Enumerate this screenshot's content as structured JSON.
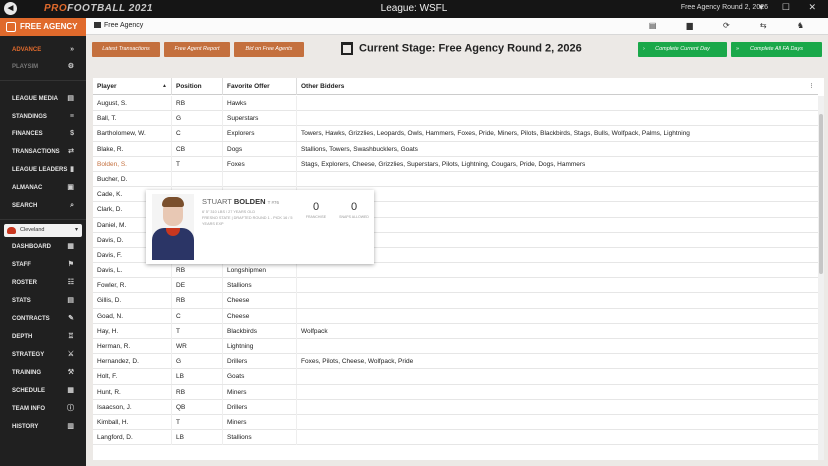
{
  "titlebar": {
    "logo_prefix": "PRO",
    "logo_suffix": "FOOTBALL 2021",
    "league": "League: WSFL",
    "stage": "Free Agency Round 2, 2026",
    "window_controls": "▾ ☐ ✕"
  },
  "sidebar": {
    "header": "FREE AGENCY",
    "advance": "ADVANCE",
    "advance_icon": "»",
    "playsim": "PLAYSIM",
    "playsim_icon": "⚙",
    "items": [
      {
        "label": "LEAGUE MEDIA",
        "icon": "▤"
      },
      {
        "label": "STANDINGS",
        "icon": "≡"
      },
      {
        "label": "FINANCES",
        "icon": "$"
      },
      {
        "label": "TRANSACTIONS",
        "icon": "⇄"
      },
      {
        "label": "LEAGUE LEADERS",
        "icon": "▮"
      },
      {
        "label": "ALMANAC",
        "icon": "▣"
      },
      {
        "label": "SEARCH",
        "icon": "⌕"
      }
    ],
    "team_select": "Cleveland",
    "team_items": [
      {
        "label": "DASHBOARD",
        "icon": "▦"
      },
      {
        "label": "STAFF",
        "icon": "⚑"
      },
      {
        "label": "ROSTER",
        "icon": "☷"
      },
      {
        "label": "STATS",
        "icon": "▤"
      },
      {
        "label": "CONTRACTS",
        "icon": "✎"
      },
      {
        "label": "DEPTH",
        "icon": "♖"
      },
      {
        "label": "STRATEGY",
        "icon": "⚔"
      },
      {
        "label": "TRAINING",
        "icon": "⚒"
      },
      {
        "label": "SCHEDULE",
        "icon": "▦"
      },
      {
        "label": "TEAM INFO",
        "icon": "ⓘ"
      },
      {
        "label": "HISTORY",
        "icon": "▥"
      }
    ]
  },
  "topbar": {
    "breadcrumb": "Free Agency",
    "icons": "▤ ▆ ⟳ ⇆ ♞"
  },
  "actions": {
    "latest_transactions": "Latest Transactions",
    "free_agent_report": "Free Agent Report",
    "bid_on_free_agents": "Bid on Free Agents",
    "stage_title": "Current Stage: Free Agency Round 2, 2026",
    "complete_day": "Complete Current Day",
    "complete_all": "Complete All FA Days",
    "complete_day_icon": "›",
    "complete_all_icon": "»"
  },
  "table": {
    "headers": [
      "Player",
      "Position",
      "Favorite Offer",
      "Other Bidders"
    ],
    "sort_indicator": "▲",
    "menu_indicator": "⋮",
    "rows": [
      {
        "player": "August, S.",
        "pos": "RB",
        "offer": "Hawks",
        "bidders": ""
      },
      {
        "player": "Ball, T.",
        "pos": "G",
        "offer": "Superstars",
        "bidders": ""
      },
      {
        "player": "Bartholomew, W.",
        "pos": "C",
        "offer": "Explorers",
        "bidders": "Towers, Hawks, Grizzlies, Leopards, Owls, Hammers, Foxes, Pride, Miners, Pilots, Blackbirds, Stags, Bulls, Wolfpack, Palms, Lightning"
      },
      {
        "player": "Blake, R.",
        "pos": "CB",
        "offer": "Dogs",
        "bidders": "Stallions, Towers, Swashbucklers, Goats"
      },
      {
        "player": "Bolden, S.",
        "pos": "T",
        "offer": "Foxes",
        "bidders": "Stags, Explorers, Cheese, Grizzlies, Superstars, Pilots, Lightning, Cougars, Pride, Dogs, Hammers"
      },
      {
        "player": "Bucher, D.",
        "pos": "",
        "offer": "",
        "bidders": ""
      },
      {
        "player": "Cade, K.",
        "pos": "",
        "offer": "",
        "bidders": ""
      },
      {
        "player": "Clark, D.",
        "pos": "",
        "offer": "",
        "bidders": ""
      },
      {
        "player": "Daniel, M.",
        "pos": "",
        "offer": "",
        "bidders": ""
      },
      {
        "player": "Davis, D.",
        "pos": "",
        "offer": "",
        "bidders": ""
      },
      {
        "player": "Davis, F.",
        "pos": "RB",
        "offer": "Cougars",
        "bidders": ""
      },
      {
        "player": "Davis, L.",
        "pos": "RB",
        "offer": "Longshipmen",
        "bidders": ""
      },
      {
        "player": "Fowler, R.",
        "pos": "DE",
        "offer": "Stallions",
        "bidders": ""
      },
      {
        "player": "Gillis, D.",
        "pos": "RB",
        "offer": "Cheese",
        "bidders": ""
      },
      {
        "player": "Goad, N.",
        "pos": "C",
        "offer": "Cheese",
        "bidders": ""
      },
      {
        "player": "Hay, H.",
        "pos": "T",
        "offer": "Blackbirds",
        "bidders": "Wolfpack"
      },
      {
        "player": "Herman, R.",
        "pos": "WR",
        "offer": "Lightning",
        "bidders": ""
      },
      {
        "player": "Hernandez, D.",
        "pos": "G",
        "offer": "Drillers",
        "bidders": "Foxes, Pilots, Cheese, Wolfpack, Pride"
      },
      {
        "player": "Holt, F.",
        "pos": "LB",
        "offer": "Goats",
        "bidders": ""
      },
      {
        "player": "Hunt, R.",
        "pos": "RB",
        "offer": "Miners",
        "bidders": ""
      },
      {
        "player": "Isaacson, J.",
        "pos": "QB",
        "offer": "Drillers",
        "bidders": ""
      },
      {
        "player": "Kimball, H.",
        "pos": "T",
        "offer": "Miners",
        "bidders": ""
      },
      {
        "player": "Langford, D.",
        "pos": "LB",
        "offer": "Stallions",
        "bidders": ""
      }
    ]
  },
  "player_card": {
    "first_name": "STUART",
    "last_name": "BOLDEN",
    "number": "T #76",
    "info_line1": "6' 5\" 310 LBS / 27 YEARS OLD",
    "info_line2": "FRESNO STATE | DRAFTED ROUND 1 - PICK 16 / 5",
    "info_line3": "YEARS EXP",
    "stat1_value": "0",
    "stat1_label": "FRANCHISE",
    "stat2_value": "0",
    "stat2_label": "SNAPS ALLOWED"
  }
}
